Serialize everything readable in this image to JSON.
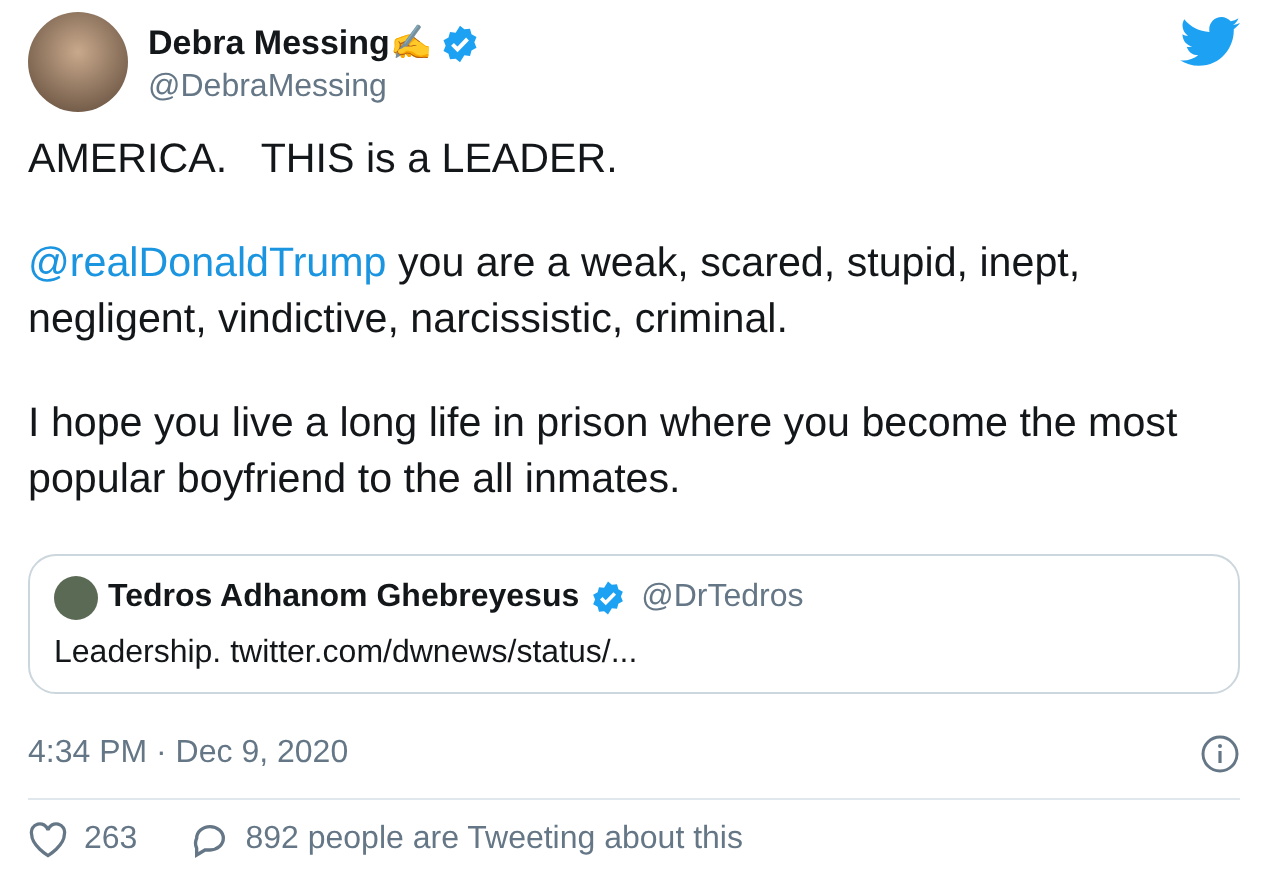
{
  "author": {
    "name": "Debra Messing✍",
    "handle": "@DebraMessing",
    "verified": true
  },
  "paragraphs": [
    {
      "text": "AMERICA.   THIS is a LEADER."
    },
    {
      "mention": "@realDonaldTrump",
      "text": " you are a weak, scared, stupid, inept, negligent, vindictive, narcissistic, criminal."
    },
    {
      "text": "I hope you live a long life in prison where you become the most popular boyfriend to the all inmates."
    }
  ],
  "quote": {
    "name": "Tedros Adhanom Ghebreyesus",
    "verified": true,
    "handle": "@DrTedros",
    "text": "Leadership. twitter.com/dwnews/status/..."
  },
  "timestamp": "4:34 PM · Dec 9, 2020",
  "actions": {
    "likes": "263",
    "talking": "892 people are Tweeting about this"
  }
}
